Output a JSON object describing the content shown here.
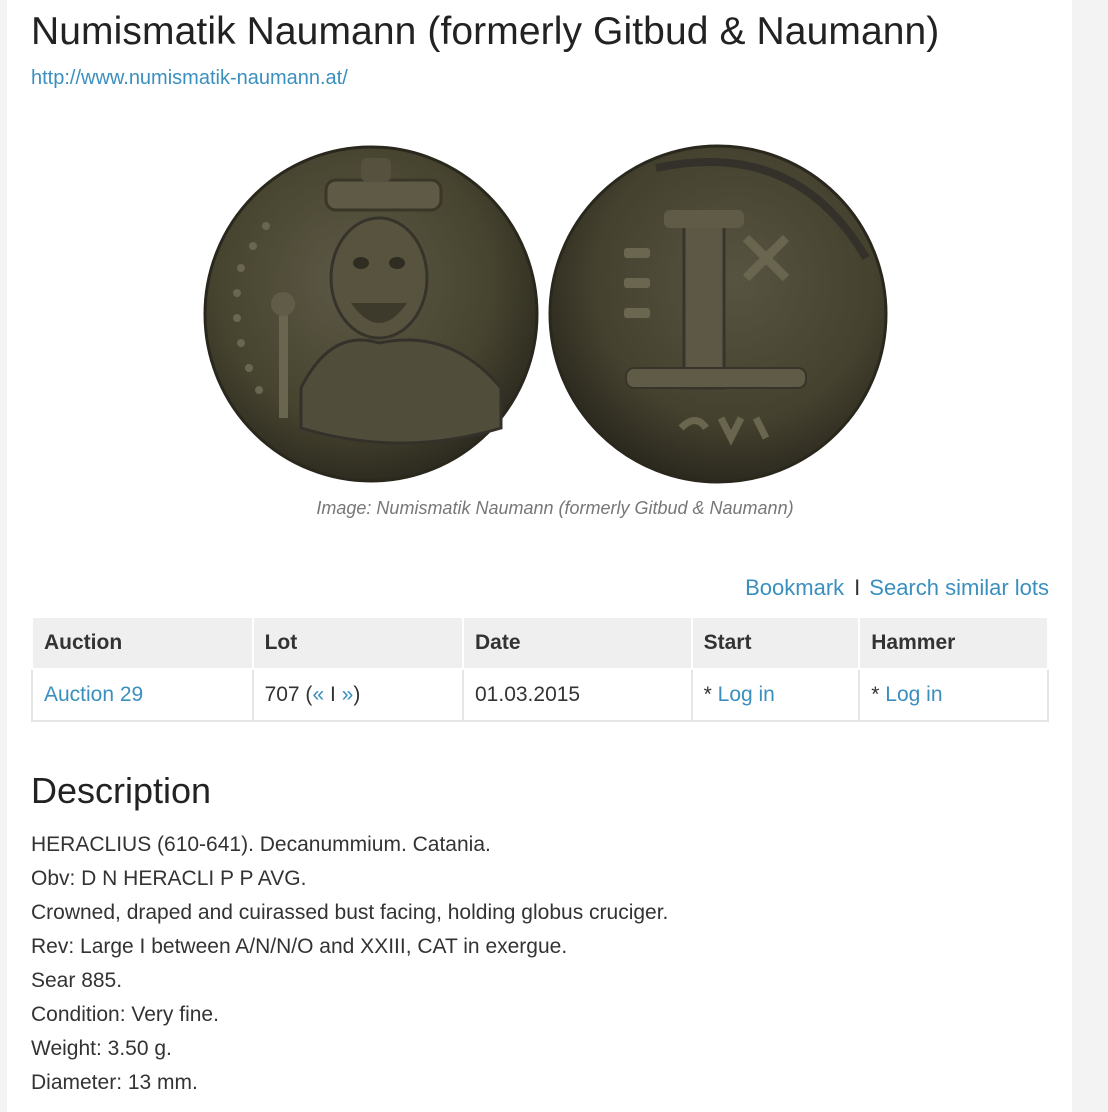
{
  "header": {
    "title": "Numismatik Naumann (formerly Gitbud & Naumann)",
    "url": "http://www.numismatik-naumann.at/"
  },
  "image": {
    "caption": "Image: Numismatik Naumann (formerly Gitbud & Naumann)"
  },
  "actions": {
    "bookmark": "Bookmark",
    "separator": "I",
    "search_similar": "Search similar lots"
  },
  "lot_table": {
    "headers": [
      "Auction",
      "Lot",
      "Date",
      "Start",
      "Hammer"
    ],
    "row": {
      "auction": "Auction 29",
      "lot_number": "707 (",
      "prev": "«",
      "lot_sep": " I ",
      "next": "»",
      "lot_close": ")",
      "date": "01.03.2015",
      "start_prefix": "* ",
      "start_link": "Log in",
      "hammer_prefix": "* ",
      "hammer_link": "Log in"
    }
  },
  "description": {
    "heading": "Description",
    "lines": [
      "HERACLIUS (610-641). Decanummium. Catania.",
      "Obv: D N HERACLI P P AVG.",
      "Crowned, draped and cuirassed bust facing, holding globus cruciger.",
      "Rev: Large I between A/N/N/O and XXIII, CAT in exergue.",
      "Sear 885.",
      "Condition: Very fine.",
      "Weight: 3.50 g.",
      "Diameter: 13 mm."
    ]
  },
  "colors": {
    "link": "#3a8fbf",
    "header_bg": "#efefef",
    "coin_bronze": "#4f4a3a"
  }
}
